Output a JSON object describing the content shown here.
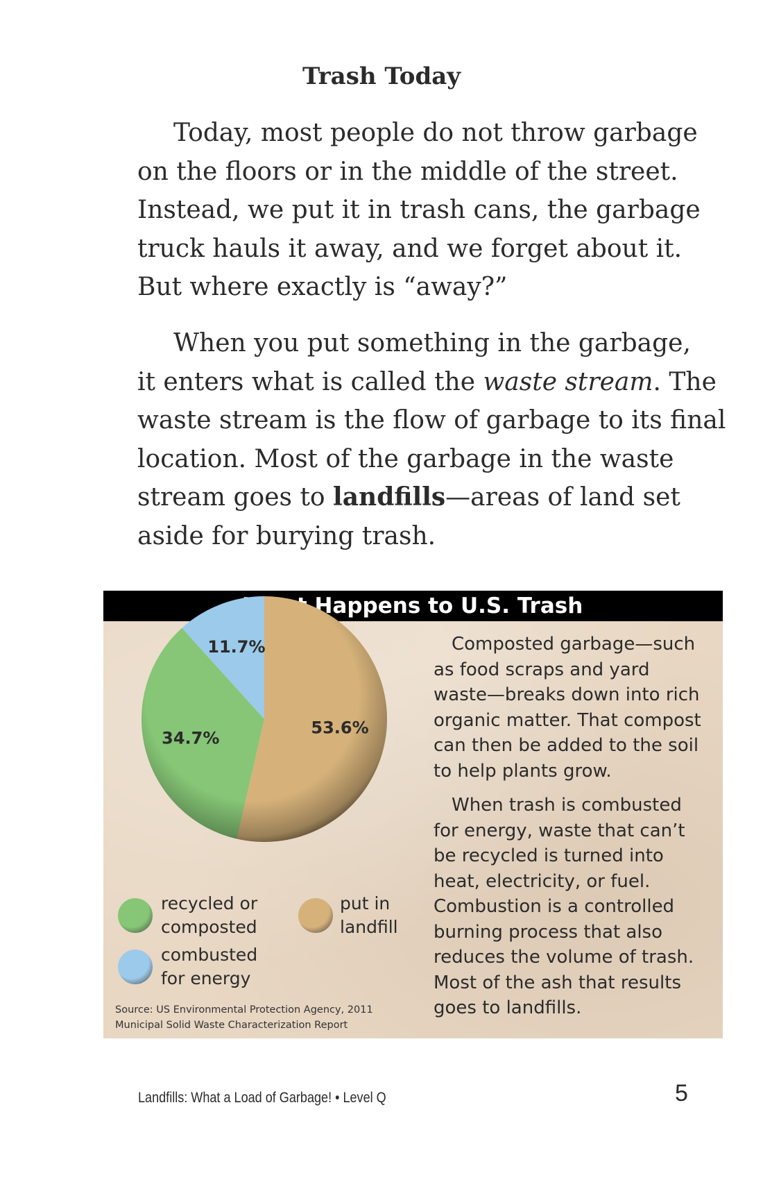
{
  "page": {
    "heading": "Trash Today",
    "paragraph1": [
      "Today, most people do not throw garbage",
      "on the floors or in the middle of the street.",
      "Instead, we put it in trash cans, the garbage",
      "truck hauls it away, and we forget about it.",
      "But where exactly is “away?”"
    ],
    "paragraph2": {
      "line1": "When you put something in the garbage,",
      "line2_before": "it enters what is called the ",
      "line2_term": "waste stream",
      "line2_after": ". The",
      "line3": "waste stream is the flow of garbage to its final",
      "line4": "location. Most of the garbage in the waste",
      "line5_before": "stream goes to ",
      "line5_term": "landfills",
      "line5_after": "—areas of land set",
      "line6": "aside for burying trash."
    }
  },
  "figure": {
    "title": "What Happens to U.S. Trash",
    "source": [
      "Source: US Environmental Protection Agency, 2011",
      "Municipal Solid Waste Characterization Report"
    ],
    "legend": {
      "recycled": [
        "recycled or",
        "composted"
      ],
      "landfill": [
        "put in",
        "landfill"
      ],
      "combusted": [
        "combusted",
        "for energy"
      ]
    },
    "sidebar": {
      "paragraph1": [
        "Composted garbage—such",
        "as food scraps and yard",
        "waste—breaks down into rich",
        "organic matter. That compost",
        "can then be added to the soil",
        "to help plants grow."
      ],
      "paragraph2": [
        "When trash is combusted",
        "for energy, waste that can’t",
        "be recycled is turned into",
        "heat, electricity, or fuel.",
        "Combustion is a controlled",
        "burning process that also",
        "reduces the volume of trash.",
        "Most of the ash that results",
        "goes to landfills."
      ]
    }
  },
  "chart_data": {
    "type": "pie",
    "title": "What Happens to U.S. Trash",
    "slices": [
      {
        "label": "put in landfill",
        "value": 53.6,
        "display": "53.6%",
        "color": "#d6b27a"
      },
      {
        "label": "recycled or composted",
        "value": 34.7,
        "display": "34.7%",
        "color": "#86c676"
      },
      {
        "label": "combusted for energy",
        "value": 11.7,
        "display": "11.7%",
        "color": "#9ccaea"
      }
    ],
    "legend_placement": "bottom-left"
  },
  "footer": {
    "book_title": "Landfills: What a Load of Garbage! • Level Q",
    "page_number": "5"
  }
}
